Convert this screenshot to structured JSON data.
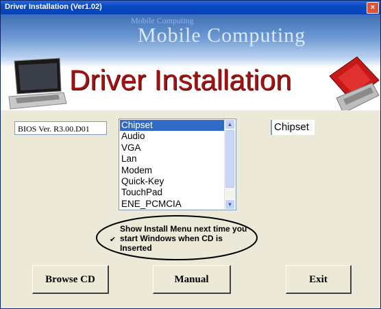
{
  "window": {
    "title": "Driver Installation (Ver1.02)",
    "close_glyph": "×"
  },
  "banner": {
    "watermark": "Mobile Computing",
    "brand": "Mobile Computing",
    "title": "Driver Installation"
  },
  "bios": {
    "version": "BIOS Ver. R3.00.D01"
  },
  "drivers": {
    "items": [
      "Chipset",
      "Audio",
      "VGA",
      "Lan",
      "Modem",
      "Quick-Key",
      "TouchPad",
      "ENE_PCMCIA"
    ],
    "selected": "Chipset"
  },
  "option": {
    "checked": true,
    "checkmark": "✔",
    "label": "Show Install Menu next time you start Windows when CD is Inserted"
  },
  "buttons": {
    "browse": "Browse CD",
    "manual": "Manual",
    "exit": "Exit"
  }
}
